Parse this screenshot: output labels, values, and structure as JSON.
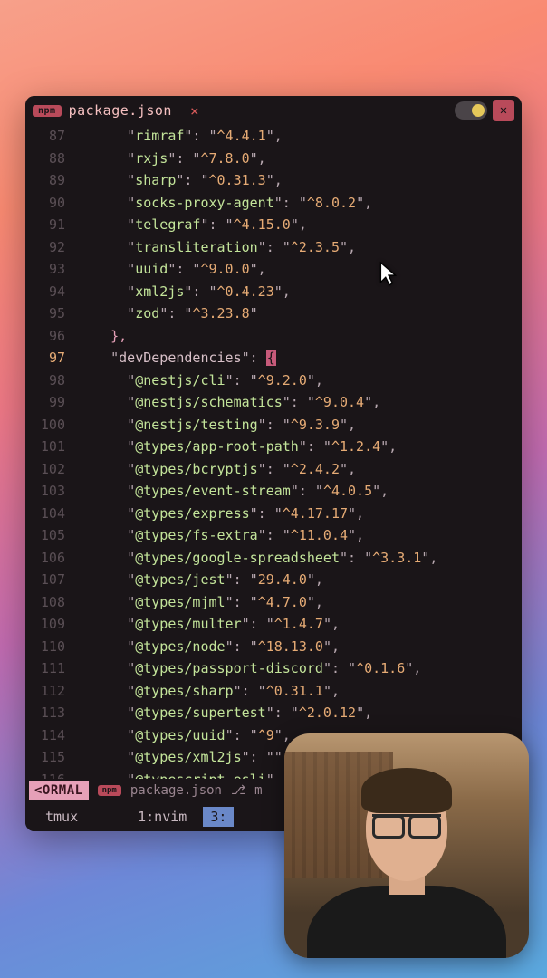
{
  "titlebar": {
    "badge": "npm",
    "filename": "package.json",
    "close": "×"
  },
  "cursor_line": 97,
  "lines": [
    {
      "n": 87,
      "ind": 3,
      "type": "entry",
      "key": "rimraf",
      "val": "^4.4.1",
      "comma": true
    },
    {
      "n": 88,
      "ind": 3,
      "type": "entry",
      "key": "rxjs",
      "val": "^7.8.0",
      "comma": true
    },
    {
      "n": 89,
      "ind": 3,
      "type": "entry",
      "key": "sharp",
      "val": "^0.31.3",
      "comma": true
    },
    {
      "n": 90,
      "ind": 3,
      "type": "entry",
      "key": "socks-proxy-agent",
      "val": "^8.0.2",
      "comma": true
    },
    {
      "n": 91,
      "ind": 3,
      "type": "entry",
      "key": "telegraf",
      "val": "^4.15.0",
      "comma": true
    },
    {
      "n": 92,
      "ind": 3,
      "type": "entry",
      "key": "transliteration",
      "val": "^2.3.5",
      "comma": true
    },
    {
      "n": 93,
      "ind": 3,
      "type": "entry",
      "key": "uuid",
      "val": "^9.0.0",
      "comma": true
    },
    {
      "n": 94,
      "ind": 3,
      "type": "entry",
      "key": "xml2js",
      "val": "^0.4.23",
      "comma": true
    },
    {
      "n": 95,
      "ind": 3,
      "type": "entry",
      "key": "zod",
      "val": "^3.23.8",
      "comma": false
    },
    {
      "n": 96,
      "ind": 2,
      "type": "close",
      "text": "},",
      "comma": false
    },
    {
      "n": 97,
      "ind": 2,
      "type": "section",
      "key": "devDependencies",
      "activeBrace": true
    },
    {
      "n": 98,
      "ind": 3,
      "type": "entry",
      "key": "@nestjs/cli",
      "val": "^9.2.0",
      "comma": true
    },
    {
      "n": 99,
      "ind": 3,
      "type": "entry",
      "key": "@nestjs/schematics",
      "val": "^9.0.4",
      "comma": true
    },
    {
      "n": 100,
      "ind": 3,
      "type": "entry",
      "key": "@nestjs/testing",
      "val": "^9.3.9",
      "comma": true
    },
    {
      "n": 101,
      "ind": 3,
      "type": "entry",
      "key": "@types/app-root-path",
      "val": "^1.2.4",
      "comma": true
    },
    {
      "n": 102,
      "ind": 3,
      "type": "entry",
      "key": "@types/bcryptjs",
      "val": "^2.4.2",
      "comma": true
    },
    {
      "n": 103,
      "ind": 3,
      "type": "entry",
      "key": "@types/event-stream",
      "val": "^4.0.5",
      "comma": true
    },
    {
      "n": 104,
      "ind": 3,
      "type": "entry",
      "key": "@types/express",
      "val": "^4.17.17",
      "comma": true
    },
    {
      "n": 105,
      "ind": 3,
      "type": "entry",
      "key": "@types/fs-extra",
      "val": "^11.0.4",
      "comma": true
    },
    {
      "n": 106,
      "ind": 3,
      "type": "entry",
      "key": "@types/google-spreadsheet",
      "val": "^3.3.1",
      "comma": true
    },
    {
      "n": 107,
      "ind": 3,
      "type": "entry",
      "key": "@types/jest",
      "val": "29.4.0",
      "comma": true
    },
    {
      "n": 108,
      "ind": 3,
      "type": "entry",
      "key": "@types/mjml",
      "val": "^4.7.0",
      "comma": true
    },
    {
      "n": 109,
      "ind": 3,
      "type": "entry",
      "key": "@types/multer",
      "val": "^1.4.7",
      "comma": true
    },
    {
      "n": 110,
      "ind": 3,
      "type": "entry",
      "key": "@types/node",
      "val": "^18.13.0",
      "comma": true
    },
    {
      "n": 111,
      "ind": 3,
      "type": "entry",
      "key": "@types/passport-discord",
      "val": "^0.1.6",
      "comma": true
    },
    {
      "n": 112,
      "ind": 3,
      "type": "entry",
      "key": "@types/sharp",
      "val": "^0.31.1",
      "comma": true
    },
    {
      "n": 113,
      "ind": 3,
      "type": "entry",
      "key": "@types/supertest",
      "val": "^2.0.12",
      "comma": true
    },
    {
      "n": 114,
      "ind": 3,
      "type": "entry",
      "key": "@types/uuid",
      "val": "^9",
      "comma": true,
      "truncated": true
    },
    {
      "n": 115,
      "ind": 3,
      "type": "entry",
      "key": "@types/xml2js",
      "val": "",
      "comma": false,
      "truncated": true
    },
    {
      "n": 116,
      "ind": 3,
      "type": "entry",
      "key": "@typescript-esli",
      "val": "",
      "comma": false,
      "truncated": true,
      "keyonly": true
    }
  ],
  "status": {
    "mode": "<ORMAL",
    "badge": "npm",
    "file": "package.json",
    "branch_glyph": "⎇",
    "branch": "m"
  },
  "tmux": {
    "session": "tmux",
    "w1": "1:nvim",
    "w2": "3:"
  }
}
